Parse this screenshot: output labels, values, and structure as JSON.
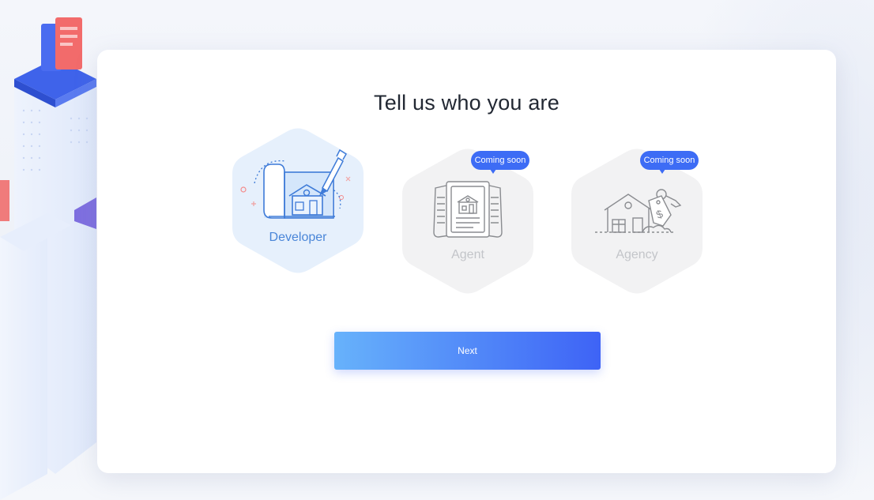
{
  "page": {
    "title": "Tell us who you are"
  },
  "roles": [
    {
      "id": "developer",
      "label": "Developer",
      "selected": true,
      "badge": ""
    },
    {
      "id": "agent",
      "label": "Agent",
      "selected": false,
      "badge": "Coming soon"
    },
    {
      "id": "agency",
      "label": "Agency",
      "selected": false,
      "badge": "Coming soon"
    }
  ],
  "actions": {
    "next_label": "Next"
  },
  "colors": {
    "accent": "#3d6cf5",
    "button_gradient_start": "#67b2fb",
    "button_gradient_end": "#3e63f6",
    "selected_hex": "#e6f0fc",
    "disabled_hex": "#f2f2f3",
    "selected_text": "#4a86d8",
    "disabled_text": "#c3c5c9"
  }
}
